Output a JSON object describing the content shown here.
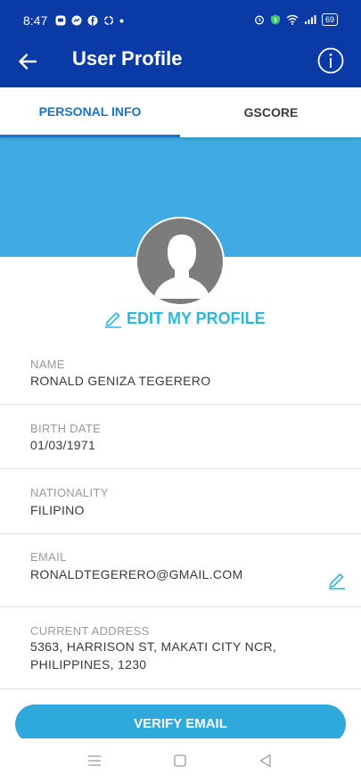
{
  "status_bar": {
    "time": "8:47",
    "battery": "69"
  },
  "app_bar": {
    "title": "User Profile"
  },
  "tabs": [
    {
      "label": "PERSONAL INFO",
      "active": true
    },
    {
      "label": "GSCORE",
      "active": false
    }
  ],
  "profile": {
    "edit_label": "EDIT MY PROFILE"
  },
  "fields": [
    {
      "label": "NAME",
      "value": "RONALD GENIZA TEGERERO"
    },
    {
      "label": "BIRTH DATE",
      "value": "01/03/1971"
    },
    {
      "label": "NATIONALITY",
      "value": "FILIPINO"
    },
    {
      "label": "EMAIL",
      "value": "RONALDTEGERERO@GMAIL.COM"
    },
    {
      "label": "CURRENT ADDRESS",
      "value_line1": "5363, HARRISON ST, MAKATI CITY NCR,",
      "value_line2": "PHILIPPINES, 1230"
    }
  ],
  "actions": {
    "verify_label": "VERIFY EMAIL"
  },
  "colors": {
    "primary": "#0a3aa6",
    "banner": "#3faae3",
    "accent": "#2bb7de",
    "tab_active": "#1a73c9"
  },
  "icons": {
    "back": "arrow-left-icon",
    "info": "info-circle-icon",
    "edit": "pencil-icon",
    "nav": [
      "menu-icon",
      "home-square-icon",
      "back-triangle-icon"
    ]
  }
}
